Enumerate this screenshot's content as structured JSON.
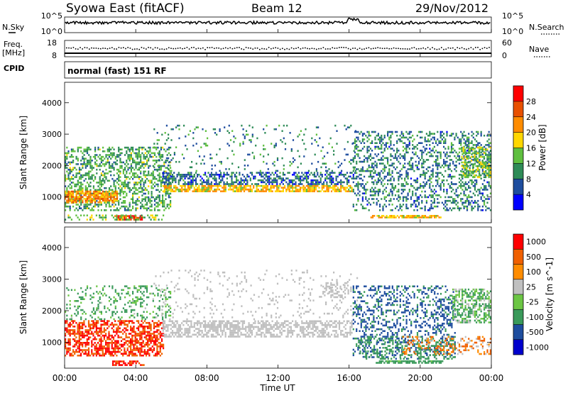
{
  "header": {
    "station": "Syowa East (fitACF)",
    "beam": "Beam 12",
    "date": "29/Nov/2012"
  },
  "panel_labels": {
    "nsky": "N.Sky",
    "freq_line1": "Freq.",
    "freq_line2": "[MHz]",
    "cpid": "CPID",
    "nsearch": "N.Search",
    "nave": "Nave",
    "mode": "normal (fast) 151 RF"
  },
  "noise_axis": {
    "top": "10^5",
    "bottom": "10^0"
  },
  "freq_axis": {
    "left_ticks": [
      "18",
      "8"
    ],
    "right_ticks": [
      "60",
      "0"
    ]
  },
  "colors": {
    "power_scale": [
      "#0000ff",
      "#1e4d9e",
      "#2e8b57",
      "#5fbf3f",
      "#ffd700",
      "#ff8c00",
      "#e85000",
      "#ff0000"
    ],
    "velocity_scale": [
      "#0000cd",
      "#1e4d9e",
      "#3a9a5a",
      "#6cc644",
      "#c0c0c0",
      "#ff8c00",
      "#f06000",
      "#ff0000"
    ],
    "ground_scatter": "#bebebe"
  },
  "chart_data": [
    {
      "type": "heatmap",
      "name": "power",
      "ylabel": "Slant Range [km]",
      "yticks": [
        1000,
        2000,
        3000,
        4000
      ],
      "ylim": [
        180,
        4650
      ],
      "xlim": [
        "00:00",
        "24:00"
      ],
      "colorbar": {
        "label": "Power [dB]",
        "ticks": [
          4,
          8,
          12,
          16,
          20,
          24,
          28
        ],
        "range": [
          0,
          30
        ]
      },
      "regions": [
        {
          "t0": 0.0,
          "t1": 6.0,
          "r0": 550,
          "r1": 2600,
          "value": 11,
          "density": 0.45
        },
        {
          "t0": 0.0,
          "t1": 3.0,
          "r0": 800,
          "r1": 1200,
          "value": 21,
          "density": 0.75
        },
        {
          "t0": 2.8,
          "t1": 4.4,
          "r0": 250,
          "r1": 420,
          "value": 26,
          "density": 0.85
        },
        {
          "t0": 0.0,
          "t1": 5.6,
          "r0": 250,
          "r1": 450,
          "value": 13,
          "density": 0.35
        },
        {
          "t0": 5.5,
          "t1": 16.2,
          "r0": 1150,
          "r1": 1380,
          "value": 18,
          "density": 0.7
        },
        {
          "t0": 5.5,
          "t1": 16.2,
          "r0": 1380,
          "r1": 1800,
          "value": 7,
          "density": 0.55
        },
        {
          "t0": 5.0,
          "t1": 16.5,
          "r0": 1800,
          "r1": 3300,
          "value": 9,
          "density": 0.08
        },
        {
          "t0": 16.2,
          "t1": 24.0,
          "r0": 550,
          "r1": 3100,
          "value": 8,
          "density": 0.35
        },
        {
          "t0": 17.2,
          "t1": 21.2,
          "r0": 320,
          "r1": 420,
          "value": 18,
          "density": 0.75
        },
        {
          "t0": 22.3,
          "t1": 24.0,
          "r0": 1600,
          "r1": 2600,
          "value": 13,
          "density": 0.6
        }
      ]
    },
    {
      "type": "heatmap",
      "name": "velocity",
      "ylabel": "Slant Range [km]",
      "xlabel": "Time UT",
      "yticks": [
        1000,
        2000,
        3000,
        4000
      ],
      "xticks": [
        "00:00",
        "04:00",
        "08:00",
        "12:00",
        "16:00",
        "20:00",
        "00:00"
      ],
      "ylim": [
        180,
        4650
      ],
      "xlim": [
        "00:00",
        "24:00"
      ],
      "colorbar": {
        "label": "Velocity [m s^-1]",
        "ticks": [
          1000,
          500,
          100,
          25,
          -25,
          -100,
          -500,
          -1000
        ]
      },
      "regions": [
        {
          "t0": 0.0,
          "t1": 5.6,
          "r0": 550,
          "r1": 1700,
          "value": -300,
          "density": 0.6
        },
        {
          "t0": 0.0,
          "t1": 6.0,
          "r0": 1700,
          "r1": 2800,
          "value": 80,
          "density": 0.2
        },
        {
          "t0": 2.5,
          "t1": 4.5,
          "r0": 250,
          "r1": 420,
          "value": -400,
          "density": 0.5
        },
        {
          "t0": 5.5,
          "t1": 16.2,
          "r0": 1150,
          "r1": 1700,
          "value": "gs",
          "density": 0.6
        },
        {
          "t0": 5.0,
          "t1": 16.5,
          "r0": 1700,
          "r1": 3300,
          "value": "gs",
          "density": 0.08
        },
        {
          "t0": 14.5,
          "t1": 16.0,
          "r0": 2400,
          "r1": 2900,
          "value": "gs",
          "density": 0.35
        },
        {
          "t0": 16.2,
          "t1": 22.0,
          "r0": 500,
          "r1": 2800,
          "value": 400,
          "density": 0.3
        },
        {
          "t0": 16.5,
          "t1": 22.0,
          "r0": 450,
          "r1": 1200,
          "value": 200,
          "density": 0.3
        },
        {
          "t0": 17.5,
          "t1": 21.3,
          "r0": 320,
          "r1": 420,
          "value": 120,
          "density": 0.7
        },
        {
          "t0": 21.8,
          "t1": 24.0,
          "r0": 1600,
          "r1": 2700,
          "value": 60,
          "density": 0.55
        },
        {
          "t0": 19.0,
          "t1": 24.0,
          "r0": 600,
          "r1": 1200,
          "value": -60,
          "density": 0.3
        }
      ]
    }
  ]
}
